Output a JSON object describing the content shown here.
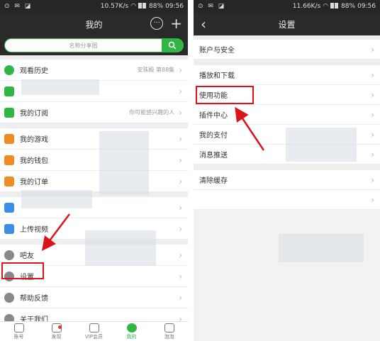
{
  "left": {
    "status": {
      "left_icons": "⊙ ✉ ◪",
      "speed": "10.57K/s",
      "battery": "88%",
      "time": "09:56"
    },
    "title": "我的",
    "search": {
      "placeholder": "名称分享图"
    },
    "rows": [
      {
        "label": "观看历史",
        "sub": "安珠殿 第88集",
        "icon_color": "#31b545",
        "icon": "clock-icon"
      },
      {
        "label": "",
        "sub": "",
        "icon_color": "#31b545",
        "icon": "star-icon"
      },
      {
        "label": "我的订阅",
        "sub": "你可能感兴趣的人",
        "icon_color": "#31b545",
        "icon": "rss-icon"
      },
      {
        "label": "我的游戏",
        "sub": "",
        "icon_color": "#f08a24",
        "icon": "gamepad-icon"
      },
      {
        "label": "我的钱包",
        "sub": "",
        "icon_color": "#f08a24",
        "icon": "wallet-icon"
      },
      {
        "label": "我的订单",
        "sub": "",
        "icon_color": "#f08a24",
        "icon": "order-icon"
      },
      {
        "label": "",
        "sub": "",
        "icon_color": "#3a8ee6",
        "icon": "download-icon"
      },
      {
        "label": "上传视频",
        "sub": "",
        "icon_color": "#3a8ee6",
        "icon": "upload-icon"
      },
      {
        "label": "吧友",
        "sub": "",
        "icon_color": "#888888",
        "icon": "location-icon"
      },
      {
        "label": "设置",
        "sub": "",
        "icon_color": "#888888",
        "icon": "gear-icon"
      },
      {
        "label": "帮助反馈",
        "sub": "",
        "icon_color": "#888888",
        "icon": "headset-icon"
      },
      {
        "label": "关于我们",
        "sub": "",
        "icon_color": "#888888",
        "icon": "person-icon"
      }
    ],
    "tabs": [
      {
        "label": "账号",
        "icon": "star-box-icon"
      },
      {
        "label": "发现",
        "icon": "planet-icon"
      },
      {
        "label": "VIP会员",
        "icon": "crown-icon"
      },
      {
        "label": "我的",
        "icon": "user-icon"
      },
      {
        "label": "泡泡",
        "icon": "bubble-icon"
      }
    ]
  },
  "right": {
    "status": {
      "left_icons": "⊙ ✉ ◪",
      "speed": "11.66K/s",
      "battery": "88%",
      "time": "09:56"
    },
    "title": "设置",
    "rows": [
      {
        "label": "账户与安全"
      },
      {
        "label": "播放和下载"
      },
      {
        "label": "使用功能"
      },
      {
        "label": "插件中心"
      },
      {
        "label": "我的支付"
      },
      {
        "label": "消息推送"
      },
      {
        "label": "清除缓存"
      },
      {
        "label": ""
      }
    ]
  },
  "colors": {
    "accent": "#31b545",
    "highlight": "#d9141c",
    "topbar": "#2a2a2a"
  }
}
